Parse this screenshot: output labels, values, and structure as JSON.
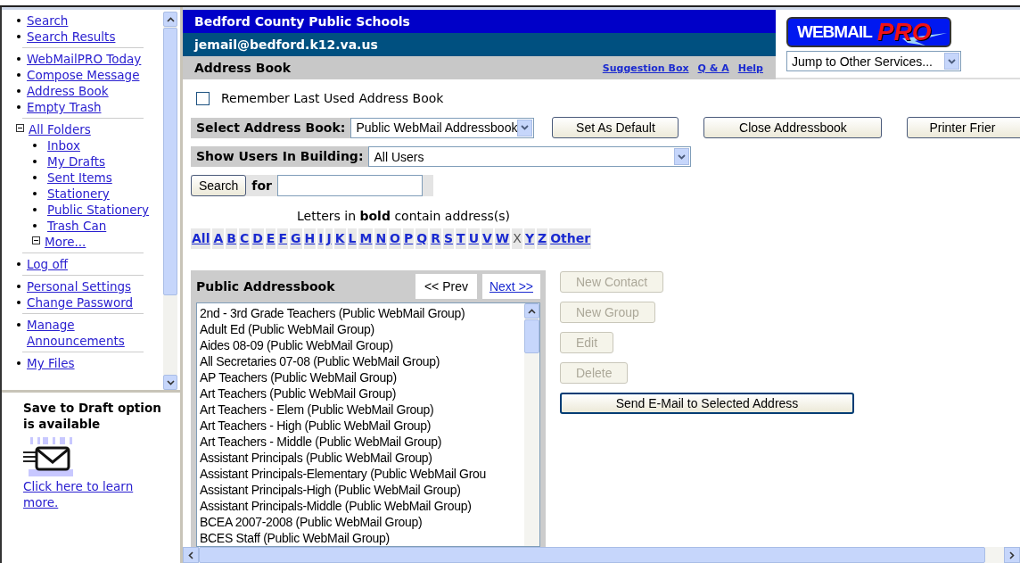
{
  "sidebar": {
    "groups": [
      [
        {
          "label": "Search"
        },
        {
          "label": "Search Results"
        }
      ],
      [
        {
          "label": "WebMailPRO Today"
        },
        {
          "label": "Compose Message"
        },
        {
          "label": "Address Book"
        },
        {
          "label": "Empty Trash"
        }
      ],
      [
        {
          "label": "All Folders",
          "expanded": true,
          "children": [
            {
              "label": "Inbox"
            },
            {
              "label": "My Drafts"
            },
            {
              "label": "Sent Items"
            },
            {
              "label": "Stationery"
            },
            {
              "label": "Public Stationery"
            },
            {
              "label": "Trash Can"
            },
            {
              "label": "More...",
              "expanded": true
            }
          ]
        }
      ],
      [
        {
          "label": "Log off"
        }
      ],
      [
        {
          "label": "Personal Settings"
        },
        {
          "label": "Change Password"
        }
      ],
      [
        {
          "label": "Manage Announcements"
        }
      ],
      [
        {
          "label": "My Files"
        }
      ]
    ]
  },
  "promo": {
    "title": "Save to Draft option is available",
    "link": "Click here to learn more."
  },
  "header": {
    "title": "Bedford County Public Schools",
    "account": "jemail@bedford.k12.va.us",
    "page_title": "Address Book",
    "links": [
      "Suggestion Box",
      "Q & A",
      "Help"
    ]
  },
  "logo": {
    "word": "WEBMAIL",
    "accent": "PRO"
  },
  "service_select": {
    "value": "Jump to Other Services..."
  },
  "remember": {
    "label": "Remember Last Used Address Book",
    "checked": false
  },
  "address_book_select": {
    "label": "Select Address Book:",
    "value": "Public WebMail Addressbook"
  },
  "book_buttons": [
    "Set As Default",
    "Close Addressbook",
    "Printer Frier"
  ],
  "building_select": {
    "label": "Show Users In Building:",
    "value": "All Users"
  },
  "search": {
    "button": "Search",
    "label": "for"
  },
  "letters_hint": "Letters in **bold** contain address(s)",
  "letters": [
    {
      "label": "All",
      "bold": true
    },
    {
      "label": "A",
      "bold": true
    },
    {
      "label": "B",
      "bold": true
    },
    {
      "label": "C",
      "bold": true
    },
    {
      "label": "D",
      "bold": true
    },
    {
      "label": "E",
      "bold": true
    },
    {
      "label": "F",
      "bold": true
    },
    {
      "label": "G",
      "bold": true
    },
    {
      "label": "H",
      "bold": true
    },
    {
      "label": "I",
      "bold": true
    },
    {
      "label": "J",
      "bold": true
    },
    {
      "label": "K",
      "bold": true
    },
    {
      "label": "L",
      "bold": true
    },
    {
      "label": "M",
      "bold": true
    },
    {
      "label": "N",
      "bold": true
    },
    {
      "label": "O",
      "bold": true
    },
    {
      "label": "P",
      "bold": true
    },
    {
      "label": "Q",
      "bold": true
    },
    {
      "label": "R",
      "bold": true
    },
    {
      "label": "S",
      "bold": true
    },
    {
      "label": "T",
      "bold": true
    },
    {
      "label": "U",
      "bold": true
    },
    {
      "label": "V",
      "bold": true
    },
    {
      "label": "W",
      "bold": true
    },
    {
      "label": "X",
      "bold": false
    },
    {
      "label": "Y",
      "bold": true
    },
    {
      "label": "Z",
      "bold": true
    },
    {
      "label": "Other",
      "bold": true
    }
  ],
  "list_panel": {
    "title": "Public Addressbook",
    "prev": {
      "label": "<< Prev",
      "disabled": true
    },
    "next": {
      "label": "Next >>",
      "disabled": false
    },
    "entries": [
      "2nd - 3rd Grade Teachers (Public WebMail Group)",
      "Adult Ed (Public WebMail Group)",
      "Aides 08-09 (Public WebMail Group)",
      "All Secretaries 07-08 (Public WebMail Group)",
      "AP Teachers (Public WebMail Group)",
      "Art Teachers (Public WebMail Group)",
      "Art Teachers - Elem (Public WebMail Group)",
      "Art Teachers - High (Public WebMail Group)",
      "Art Teachers - Middle (Public WebMail Group)",
      "Assistant Principals (Public WebMail Group)",
      "Assistant Principals-Elementary (Public WebMail Grou",
      "Assistant Principals-High (Public WebMail Group)",
      "Assistant Principals-Middle (Public WebMail Group)",
      "BCEA 2007-2008 (Public WebMail Group)",
      "BCES Staff (Public WebMail Group)"
    ]
  },
  "actions": [
    {
      "label": "New Contact",
      "disabled": true,
      "focused": false
    },
    {
      "label": "New Group",
      "disabled": true,
      "focused": false
    },
    {
      "label": "Edit",
      "disabled": true,
      "focused": false
    },
    {
      "label": "Delete",
      "disabled": true,
      "focused": false
    },
    {
      "label": "Send E-Mail to Selected Address",
      "disabled": false,
      "focused": true
    }
  ]
}
